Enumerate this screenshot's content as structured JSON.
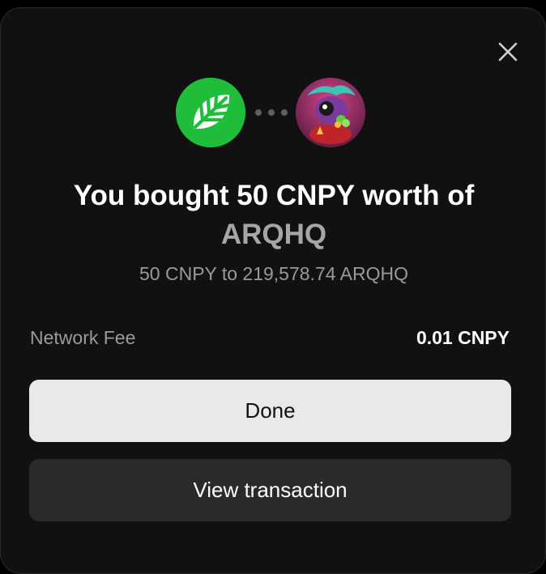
{
  "dialog": {
    "close_icon": "close-icon",
    "from_token_icon": "leaf-logo-icon",
    "to_token_icon": "arqhq-avatar-icon",
    "separator_icon": "ellipsis-icon",
    "title_line1": "You bought 50 CNPY worth of",
    "title_line2": "ARQHQ",
    "subtitle": "50 CNPY to 219,578.74 ARQHQ",
    "fee_label": "Network Fee",
    "fee_value": "0.01 CNPY",
    "done_label": "Done",
    "view_label": "View transaction"
  },
  "colors": {
    "background": "#111111",
    "brand_green": "#1fbd3a",
    "primary_button": "#e9e9e9",
    "secondary_button": "#2a2a2a",
    "muted_text": "#9a9a9a"
  }
}
